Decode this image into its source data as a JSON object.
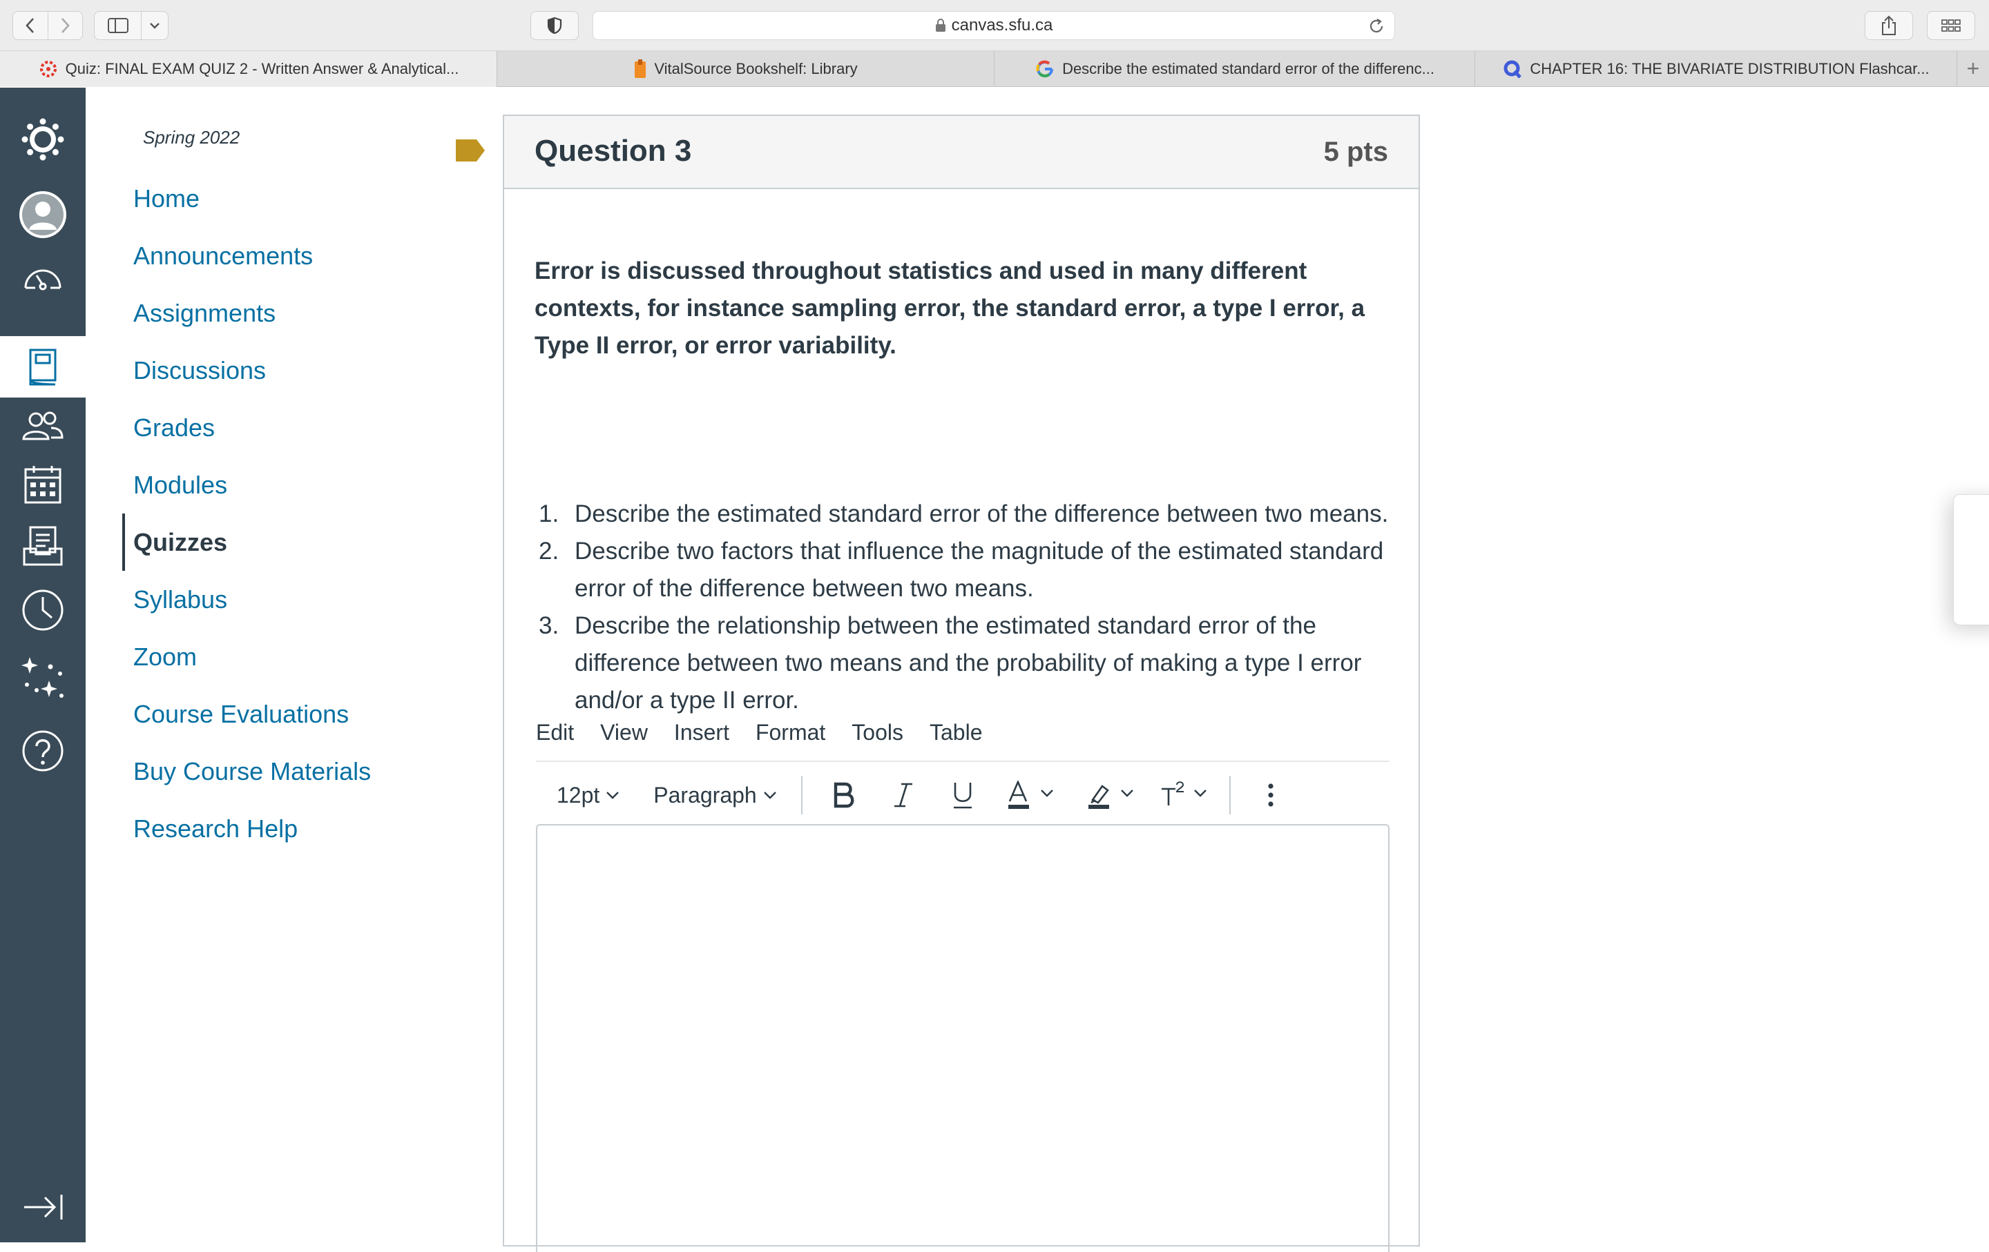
{
  "browser": {
    "url": "canvas.sfu.ca",
    "tabs": [
      {
        "label": "Quiz: FINAL EXAM QUIZ 2 - Written Answer & Analytical...",
        "icon": "canvas-icon",
        "active": true
      },
      {
        "label": "VitalSource Bookshelf: Library",
        "icon": "vitalsource-icon",
        "active": false
      },
      {
        "label": "Describe the estimated standard error of the differenc...",
        "icon": "google-icon",
        "active": false
      },
      {
        "label": "CHAPTER 16: THE BIVARIATE DISTRIBUTION Flashcar...",
        "icon": "quizlet-icon",
        "active": false
      }
    ]
  },
  "global_nav": {
    "items": [
      "canvas-logo",
      "account",
      "dashboard",
      "courses",
      "groups",
      "calendar",
      "inbox",
      "history",
      "commons",
      "help"
    ],
    "active": "courses"
  },
  "course": {
    "term": "Spring 2022",
    "nav": [
      {
        "label": "Home"
      },
      {
        "label": "Announcements"
      },
      {
        "label": "Assignments"
      },
      {
        "label": "Discussions"
      },
      {
        "label": "Grades"
      },
      {
        "label": "Modules"
      },
      {
        "label": "Quizzes",
        "active": true
      },
      {
        "label": "Syllabus"
      },
      {
        "label": "Zoom"
      },
      {
        "label": "Course Evaluations"
      },
      {
        "label": "Buy Course Materials"
      },
      {
        "label": "Research Help"
      }
    ]
  },
  "question": {
    "title": "Question 3",
    "points": "5 pts",
    "lead": "Error is discussed throughout statistics and used in many different contexts, for instance sampling error, the standard error, a type I error, a Type II error, or error variability.",
    "items": [
      {
        "num": "1.",
        "text": "Describe the estimated standard error of the difference between two means."
      },
      {
        "num": "2.",
        "text": "Describe two factors that influence the magnitude of the estimated standard error of the difference between two means."
      },
      {
        "num": "3.",
        "text": "Describe the relationship between the estimated standard error of the difference between two means  and the probability of making a type I error and/or a type II error."
      }
    ]
  },
  "editor": {
    "menu": [
      "Edit",
      "View",
      "Insert",
      "Format",
      "Tools",
      "Table"
    ],
    "font_size": "12pt",
    "block_format": "Paragraph",
    "value": ""
  },
  "colors": {
    "link": "#0770a3",
    "nav_bg": "#394b58",
    "flag": "#c09420"
  }
}
